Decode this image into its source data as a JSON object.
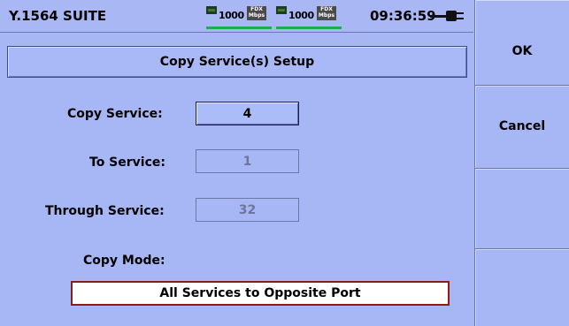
{
  "status_bar": {
    "app_title": "Y.1564 SUITE",
    "port1": {
      "speed": "1000",
      "duplex": "FDX",
      "unit": "Mbps"
    },
    "port2": {
      "speed": "1000",
      "duplex": "FDX",
      "unit": "Mbps"
    },
    "clock": "09:36:59",
    "power_icon": "ac-power-plug-icon"
  },
  "header": {
    "title": "Copy Service(s) Setup"
  },
  "form": {
    "copy_service": {
      "label": "Copy Service:",
      "value": "4"
    },
    "to_service": {
      "label": "To Service:",
      "value": "1"
    },
    "through_service": {
      "label": "Through Service:",
      "value": "32"
    },
    "copy_mode": {
      "label": "Copy Mode:",
      "value": "All Services to Opposite Port"
    }
  },
  "softkeys": [
    {
      "label": "OK"
    },
    {
      "label": "Cancel"
    },
    {
      "label": ""
    },
    {
      "label": ""
    }
  ],
  "colors": {
    "background": "#a7b6f5",
    "link_indicator": "#15b24a",
    "selection_border": "#8c1c14",
    "disabled_text": "#6d7599"
  }
}
